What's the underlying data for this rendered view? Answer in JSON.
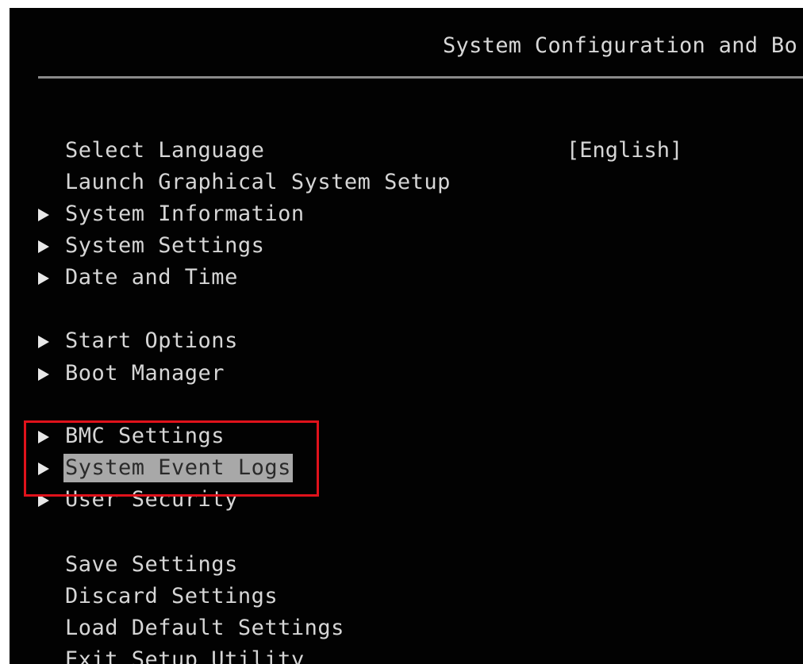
{
  "header": {
    "title": "System Configuration and Bo"
  },
  "menu": {
    "select_language": {
      "label": "Select Language",
      "value": "[English]"
    },
    "launch_graphical": {
      "label": "Launch Graphical System Setup"
    },
    "system_information": {
      "label": "System Information"
    },
    "system_settings": {
      "label": "System Settings"
    },
    "date_and_time": {
      "label": "Date and Time"
    },
    "start_options": {
      "label": "Start Options"
    },
    "boot_manager": {
      "label": "Boot Manager"
    },
    "bmc_settings": {
      "label": "BMC Settings"
    },
    "system_event_logs": {
      "label": "System Event Logs"
    },
    "user_security": {
      "label": "User Security"
    },
    "save_settings": {
      "label": "Save Settings"
    },
    "discard_settings": {
      "label": "Discard Settings"
    },
    "load_default_settings": {
      "label": "Load Default Settings"
    },
    "exit_setup_utility": {
      "label": "Exit Setup Utility"
    }
  },
  "colors": {
    "background": "#020202",
    "text": "#d6d6d6",
    "selection": "#a8a8a8",
    "annotation_box": "#e0121b"
  },
  "icons": {
    "submenu": "triangle-right-icon"
  }
}
